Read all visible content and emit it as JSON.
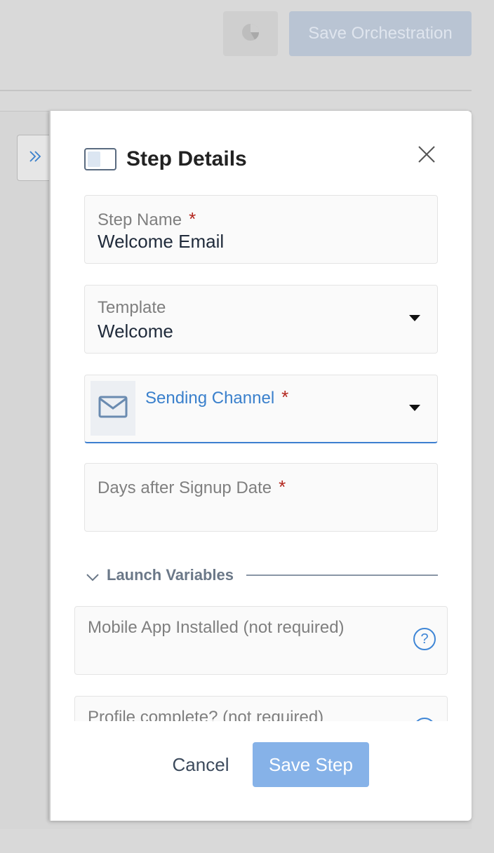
{
  "toolbar": {
    "chart_icon": "pie-chart-icon",
    "save_orchestration_label": "Save Orchestration"
  },
  "sidebar_toggle": {
    "icon": "double-chevron-right-icon"
  },
  "drawer": {
    "title": "Step Details",
    "title_icon": "panel-icon",
    "close_icon": "close-icon",
    "fields": {
      "step_name": {
        "label": "Step Name",
        "required_mark": "*",
        "value": "Welcome Email"
      },
      "template": {
        "label": "Template",
        "value": "Welcome"
      },
      "sending_channel": {
        "label": "Sending Channel",
        "required_mark": "*",
        "value": "",
        "icon": "mail-icon"
      },
      "days_after_signup": {
        "label": "Days after Signup Date",
        "required_mark": "*",
        "value": ""
      }
    },
    "launch_variables": {
      "title": "Launch Variables",
      "items": [
        {
          "label": "Mobile App Installed (not required)",
          "help": "?"
        },
        {
          "label": "Profile complete? (not required)",
          "help": "?"
        }
      ]
    },
    "footer": {
      "cancel_label": "Cancel",
      "save_label": "Save Step"
    }
  },
  "colors": {
    "accent": "#3a80cc",
    "required": "#b3261e",
    "primary_button": "#86b2e8"
  }
}
